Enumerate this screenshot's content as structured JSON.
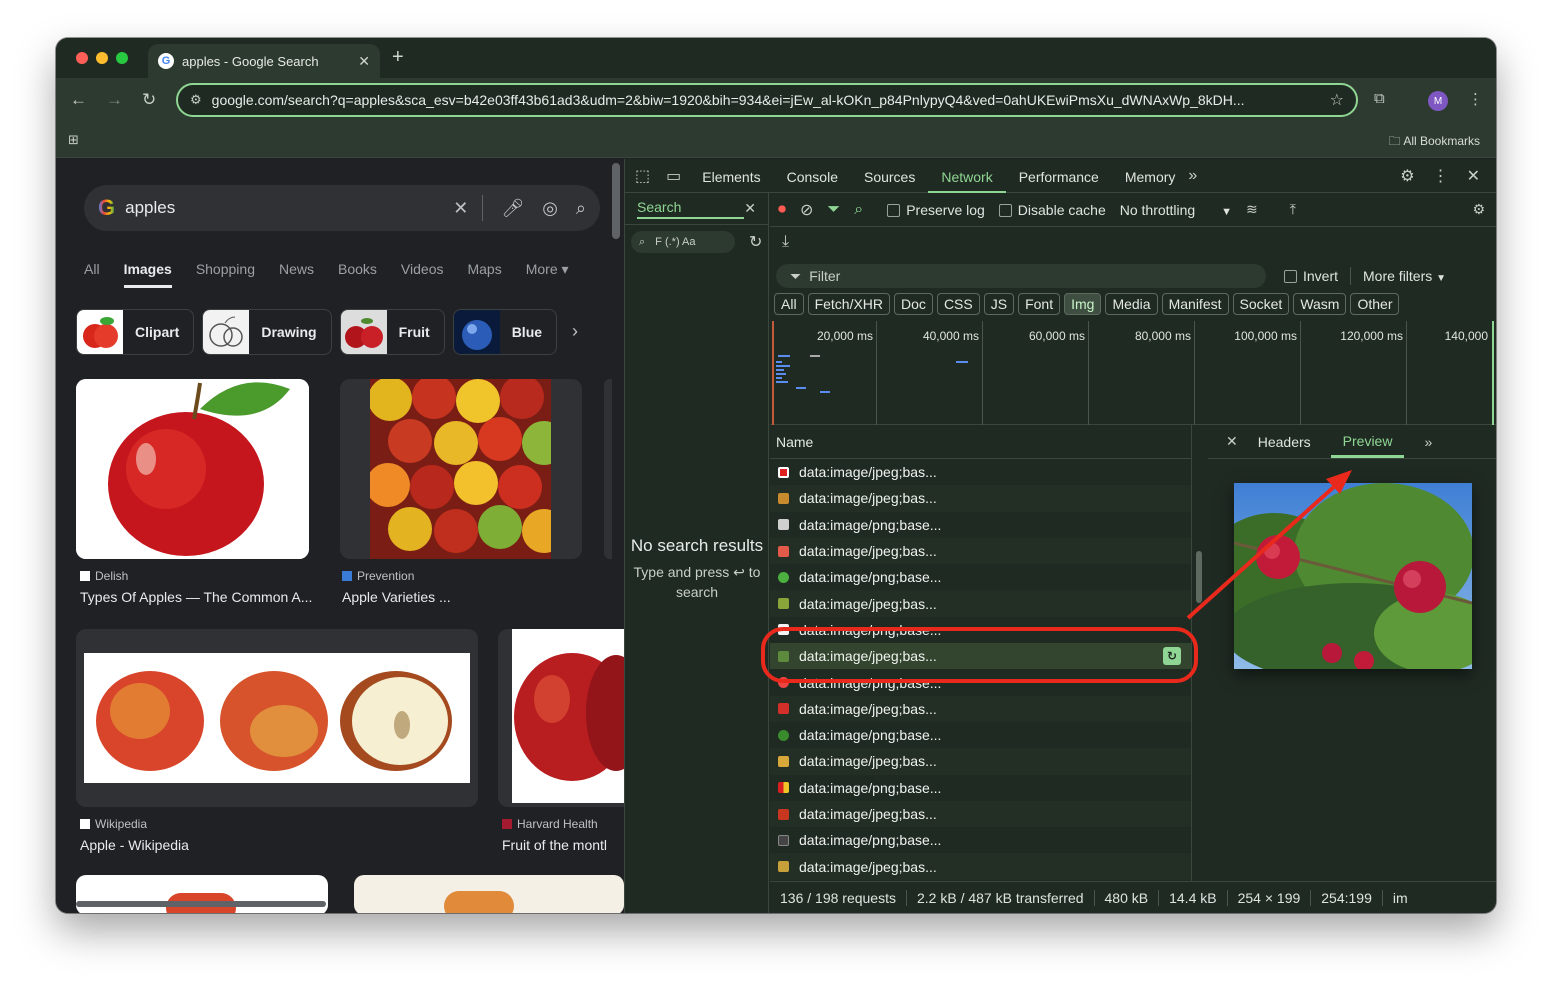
{
  "window": {
    "tab_title": "apples - Google Search",
    "tab_favicon": "G",
    "url": "google.com/search?q=apples&sca_esv=b42e03ff43b61ad3&udm=2&biw=1920&bih=934&ei=jEw_al-kOKn_p84PnlypyQ4&ved=0ahUKEwiPmsXu_dWNAxWp_8kDH...",
    "avatar_initial": "M",
    "all_bookmarks": "All Bookmarks"
  },
  "google": {
    "query": "apples",
    "tabs": [
      "All",
      "Images",
      "Shopping",
      "News",
      "Books",
      "Videos",
      "Maps",
      "More"
    ],
    "active_tab": "Images",
    "chips": [
      "Clipart",
      "Drawing",
      "Fruit",
      "Blue"
    ],
    "results": [
      {
        "source": "Delish",
        "caption": "Types Of Apples — The Common A..."
      },
      {
        "source": "Prevention",
        "caption": "Apple Varieties ..."
      },
      {
        "source": "Wikipedia",
        "caption": "Apple - Wikipedia"
      },
      {
        "source": "Harvard Health",
        "caption": "Fruit of the montl"
      }
    ]
  },
  "devtools": {
    "tabs": [
      "Elements",
      "Console",
      "Sources",
      "Network",
      "Performance",
      "Memory"
    ],
    "active_tab": "Network",
    "search": {
      "label": "Search",
      "options": "F (.*) Aa",
      "no_results_title": "No search results",
      "no_results_hint": "Type and press ↩ to search"
    },
    "network": {
      "preserve_log": "Preserve log",
      "disable_cache": "Disable cache",
      "throttling": "No throttling",
      "filter_placeholder": "Filter",
      "invert": "Invert",
      "more_filters": "More filters",
      "types": [
        "All",
        "Fetch/XHR",
        "Doc",
        "CSS",
        "JS",
        "Font",
        "Img",
        "Media",
        "Manifest",
        "Socket",
        "Wasm",
        "Other"
      ],
      "active_type": "Img",
      "timeline_labels": [
        "20,000 ms",
        "40,000 ms",
        "60,000 ms",
        "80,000 ms",
        "100,000 ms",
        "120,000 ms",
        "140,000"
      ],
      "name_header": "Name",
      "requests": [
        "data:image/jpeg;bas...",
        "data:image/jpeg;bas...",
        "data:image/png;base...",
        "data:image/jpeg;bas...",
        "data:image/png;base...",
        "data:image/jpeg;bas...",
        "data:image/png;base...",
        "data:image/jpeg;bas...",
        "data:image/png;base...",
        "data:image/jpeg;bas...",
        "data:image/png;base...",
        "data:image/jpeg;bas...",
        "data:image/png;base...",
        "data:image/jpeg;bas...",
        "data:image/png;base...",
        "data:image/jpeg;bas..."
      ],
      "selected_index": 7,
      "detail_tabs": [
        "Headers",
        "Preview"
      ],
      "active_detail_tab": "Preview",
      "status": [
        "136 / 198 requests",
        "2.2 kB / 487 kB transferred",
        "480 kB",
        "14.4 kB",
        "254 × 199",
        "254:199",
        "im"
      ]
    }
  },
  "colors": {
    "accent": "#8fd694",
    "annotation_red": "#e8291c"
  }
}
